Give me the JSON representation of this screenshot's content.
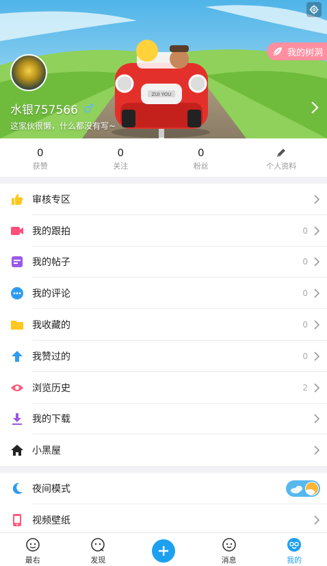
{
  "profile": {
    "username": "水银757566",
    "gender_symbol": "♂",
    "bio": "这家伙很懒，什么都没有写~",
    "tree_hole_label": "我的树洞",
    "car_plate": "ZUI YOU"
  },
  "stats": [
    {
      "value": "0",
      "label": "获赞"
    },
    {
      "value": "0",
      "label": "关注"
    },
    {
      "value": "0",
      "label": "粉丝"
    },
    {
      "label": "个人资料",
      "icon": "pencil-icon"
    }
  ],
  "menu_primary": [
    {
      "label": "审核专区",
      "count": "",
      "icon": "thumbs-up-icon",
      "color": "#ffc81e"
    },
    {
      "label": "我的跟拍",
      "count": "0",
      "icon": "video-camera-icon",
      "color": "#ff4f7a"
    },
    {
      "label": "我的帖子",
      "count": "0",
      "icon": "post-icon",
      "color": "#9b59e8"
    },
    {
      "label": "我的评论",
      "count": "0",
      "icon": "comment-icon",
      "color": "#2e9cf3"
    },
    {
      "label": "我收藏的",
      "count": "0",
      "icon": "folder-icon",
      "color": "#ffc81e"
    },
    {
      "label": "我赞过的",
      "count": "0",
      "icon": "arrow-up-icon",
      "color": "#2e9cf3"
    },
    {
      "label": "浏览历史",
      "count": "2",
      "icon": "eye-icon",
      "color": "#ff5a7a"
    },
    {
      "label": "我的下载",
      "count": "",
      "icon": "download-icon",
      "color": "#9b59e8"
    },
    {
      "label": "小黑屋",
      "count": "",
      "icon": "home-icon",
      "color": "#222222"
    }
  ],
  "menu_secondary": [
    {
      "label": "夜间模式",
      "icon": "moon-icon",
      "color": "#2e9cf3",
      "toggle_on": true
    },
    {
      "label": "视频壁纸",
      "icon": "phone-icon",
      "color": "#ff5a7a"
    }
  ],
  "bottom_nav": [
    {
      "label": "最右",
      "icon": "zuiyou-icon"
    },
    {
      "label": "发现",
      "icon": "discover-icon"
    },
    {
      "label": "",
      "icon": "plus-icon"
    },
    {
      "label": "消息",
      "icon": "message-icon"
    },
    {
      "label": "我的",
      "icon": "profile-icon",
      "active": true
    }
  ],
  "colors": {
    "accent": "#1ea0f0",
    "tree_hole": "#ff8fa0"
  }
}
